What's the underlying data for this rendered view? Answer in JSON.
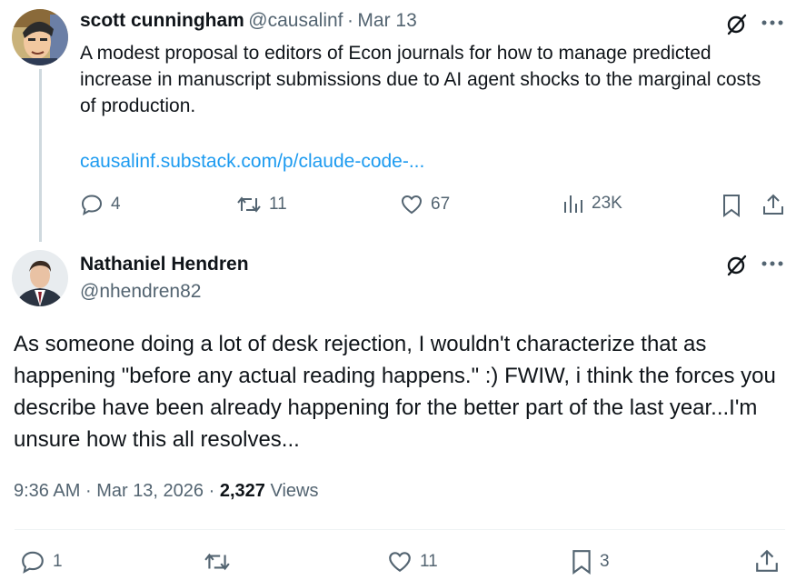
{
  "tweet1": {
    "author_name": "scott cunningham",
    "handle": "@causalinf",
    "separator": "·",
    "date": "Mar 13",
    "text": "A modest proposal to editors of Econ journals for how to manage predicted increase in manuscript submissions due to AI agent shocks to the marginal costs of production.",
    "link": "causalinf.substack.com/p/claude-code-...",
    "actions": {
      "replies": "4",
      "reposts": "11",
      "likes": "67",
      "views": "23K"
    }
  },
  "tweet2": {
    "author_name": "Nathaniel Hendren",
    "handle": "@nhendren82",
    "text": "As someone doing a lot of desk rejection, I wouldn't characterize that as happening \"before any actual reading happens.\" :) FWIW, i think the forces you describe have been already happening for the better part of the last year...I'm unsure how this all resolves...",
    "time": "9:36 AM",
    "date": "Mar 13, 2026",
    "sep": "·",
    "views_count": "2,327",
    "views_label": "Views",
    "actions": {
      "replies": "1",
      "likes": "11",
      "bookmarks": "3"
    }
  },
  "icons": {
    "grok": "grok-icon",
    "more": "more-icon",
    "reply": "reply-icon",
    "repost": "repost-icon",
    "like": "heart-icon",
    "views": "views-icon",
    "bookmark": "bookmark-icon",
    "share": "share-icon"
  },
  "colors": {
    "text": "#0f1419",
    "muted": "#536471",
    "link": "#1d9bf0",
    "thread_line": "#cfd9de"
  }
}
